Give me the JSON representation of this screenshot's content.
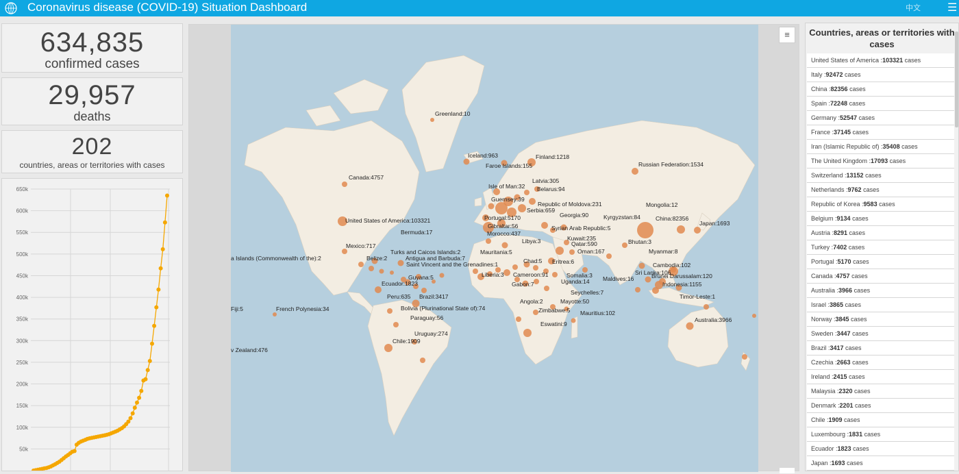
{
  "header": {
    "title": "Coronavirus disease (COVID-19) Situation Dashboard",
    "language_link": "中文",
    "logo_icon": "who-emblem-icon",
    "menu_icon": "hamburger-menu-icon",
    "bar_color": "#0fa7e2"
  },
  "stats": {
    "confirmed_value": "634,835",
    "confirmed_label": "confirmed cases",
    "deaths_value": "29,957",
    "deaths_label": "deaths",
    "countries_value": "202",
    "countries_label": "countries, areas or territories with cases"
  },
  "chart_data": {
    "type": "line",
    "title": "",
    "xlabel": "",
    "ylabel": "",
    "ylim": [
      0,
      650000
    ],
    "yticks": [
      "50k",
      "100k",
      "150k",
      "200k",
      "250k",
      "300k",
      "350k",
      "400k",
      "450k",
      "500k",
      "550k",
      "600k",
      "650k"
    ],
    "grid": true,
    "color": "#f5a700",
    "series": [
      {
        "name": "",
        "values": [
          0,
          1000,
          2000,
          3000,
          4000,
          5000,
          6000,
          7500,
          9500,
          12000,
          14500,
          17500,
          20500,
          24500,
          28500,
          32500,
          36000,
          40000,
          43500,
          45000,
          60000,
          64000,
          67000,
          69000,
          71000,
          73000,
          74500,
          75500,
          76500,
          77500,
          78500,
          79500,
          80500,
          81500,
          82500,
          84000,
          86000,
          88000,
          90000,
          92000,
          95000,
          98000,
          102000,
          107000,
          113000,
          121000,
          132000,
          145000,
          157000,
          168000,
          184000,
          208000,
          211000,
          232000,
          253000,
          293000,
          334000,
          377000,
          418000,
          467000,
          511000,
          573000,
          635000
        ]
      }
    ]
  },
  "map": {
    "list_toggle_icon": "list-icon",
    "dot_color": "#e08a50",
    "land_color": "#f3ede2",
    "water_color": "#b6cfde",
    "labels": [
      "Greenland:10",
      "Iceland:963",
      "Finland:1218",
      "Faroe Islands:155",
      "Russian Federation:1534",
      "Latvia:305",
      "Canada:4757",
      "Isle of Man:32",
      "Belarus:94",
      "Guernsey:39",
      "Republic of Moldova:231",
      "Mongolia:12",
      "Serbia:659",
      "Georgia:90",
      "Kyrgyzstan:84",
      "China:82356",
      "Japan:1693",
      "United States of America:103321",
      "Portugal:5170",
      "Gibraltar:56",
      "Syrian Arab Republic:5",
      "Bermuda:17",
      "Morocco:437",
      "Kuwait:235",
      "Libya:3",
      "Qatar:590",
      "Bhutan:3",
      "Mexico:717",
      "Oman:167",
      "Myanmar:8",
      "Turks and Caicos Islands:2",
      "Mauritania:5",
      "Belize:2",
      "Antigua and Barbuda:7",
      "Saint Vincent and the Grenadines:1",
      "Chad:5",
      "Eritrea:6",
      "Cambodia:102",
      "Guyana:5",
      "Liberia:3",
      "Cameroon:91",
      "Somalia:3",
      "Sri Lanka:106",
      "Brunei Darussalam:120",
      "Ecuador:1823",
      "Gabon:7",
      "Uganda:14",
      "Maldives:16",
      "Indonesia:1155",
      "Seychelles:7",
      "Peru:635",
      "Brazil:3417",
      "Timor-Leste:1",
      "Angola:2",
      "Mayotte:50",
      "Bolivia (Plurinational State of):74",
      "French Polynesia:34",
      "Fiji:5",
      "Zimbabwe:5",
      "Mauritius:102",
      "Paraguay:56",
      "Eswatini:9",
      "Australia:3966",
      "Uruguay:274",
      "Chile:1909",
      "v Zealand:476",
      "a Islands (Commonwealth of the):2"
    ]
  },
  "country_list": {
    "title": "Countries, areas or territories with cases",
    "suffix": " cases",
    "rows": [
      {
        "name": "United States of America",
        "count": "103321"
      },
      {
        "name": "Italy",
        "count": "92472"
      },
      {
        "name": "China",
        "count": "82356"
      },
      {
        "name": "Spain",
        "count": "72248"
      },
      {
        "name": "Germany",
        "count": "52547"
      },
      {
        "name": "France",
        "count": "37145"
      },
      {
        "name": "Iran (Islamic Republic of)",
        "count": "35408"
      },
      {
        "name": "The United Kingdom",
        "count": "17093"
      },
      {
        "name": "Switzerland",
        "count": "13152"
      },
      {
        "name": "Netherlands",
        "count": "9762"
      },
      {
        "name": "Republic of Korea",
        "count": "9583"
      },
      {
        "name": "Belgium",
        "count": "9134"
      },
      {
        "name": "Austria",
        "count": "8291"
      },
      {
        "name": "Turkey",
        "count": "7402"
      },
      {
        "name": "Portugal",
        "count": "5170"
      },
      {
        "name": "Canada",
        "count": "4757"
      },
      {
        "name": "Australia",
        "count": "3966"
      },
      {
        "name": "Israel",
        "count": "3865"
      },
      {
        "name": "Norway",
        "count": "3845"
      },
      {
        "name": "Sweden",
        "count": "3447"
      },
      {
        "name": "Brazil",
        "count": "3417"
      },
      {
        "name": "Czechia",
        "count": "2663"
      },
      {
        "name": "Ireland",
        "count": "2415"
      },
      {
        "name": "Malaysia",
        "count": "2320"
      },
      {
        "name": "Denmark",
        "count": "2201"
      },
      {
        "name": "Chile",
        "count": "1909"
      },
      {
        "name": "Luxembourg",
        "count": "1831"
      },
      {
        "name": "Ecuador",
        "count": "1823"
      },
      {
        "name": "Japan",
        "count": "1693"
      }
    ]
  }
}
